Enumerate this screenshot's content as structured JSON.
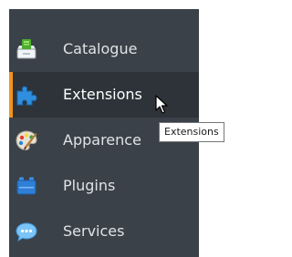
{
  "sidebar": {
    "items": [
      {
        "label": "Catalogue",
        "icon": "catalogue-icon",
        "active": false
      },
      {
        "label": "Extensions",
        "icon": "puzzle-piece-icon",
        "active": true
      },
      {
        "label": "Apparence",
        "icon": "paint-palette-icon",
        "active": false
      },
      {
        "label": "Plugins",
        "icon": "plugins-icon",
        "active": false
      },
      {
        "label": "Services",
        "icon": "chat-bubble-icon",
        "active": false
      }
    ]
  },
  "tooltip": {
    "text": "Extensions"
  },
  "colors": {
    "sidebar_bg": "#3a4148",
    "active_bg": "#2d3339",
    "active_indicator": "#f29419",
    "label_text": "#dfe3e6"
  }
}
